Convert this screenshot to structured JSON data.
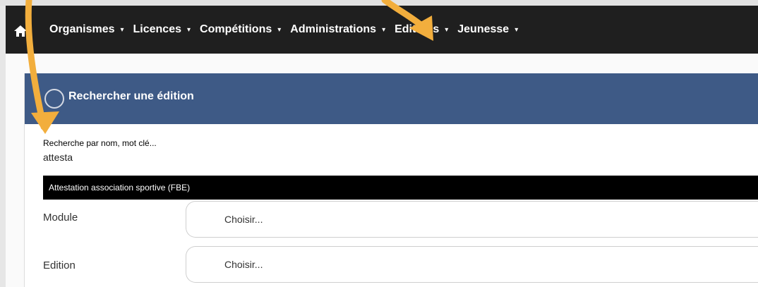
{
  "navbar": {
    "home_icon": "home-icon",
    "items": [
      {
        "label": "Organismes"
      },
      {
        "label": "Licences"
      },
      {
        "label": "Compétitions"
      },
      {
        "label": "Administrations"
      },
      {
        "label": "Editions"
      },
      {
        "label": "Jeunesse"
      }
    ],
    "caret": "▾"
  },
  "panel": {
    "icon": "search-circle-icon",
    "title": "Rechercher une édition"
  },
  "search": {
    "label": "Recherche par nom, mot clé...",
    "value": "attesta",
    "suggestion": "Attestation association sportive (FBE)"
  },
  "form": {
    "module_label": "Module",
    "module_placeholder": "Choisir...",
    "edition_label": "Edition",
    "edition_placeholder": "Choisir..."
  },
  "colors": {
    "navbar": "#1f1f1f",
    "panel_header": "#3e5a86",
    "annotation_arrow": "#f2ae3d"
  }
}
